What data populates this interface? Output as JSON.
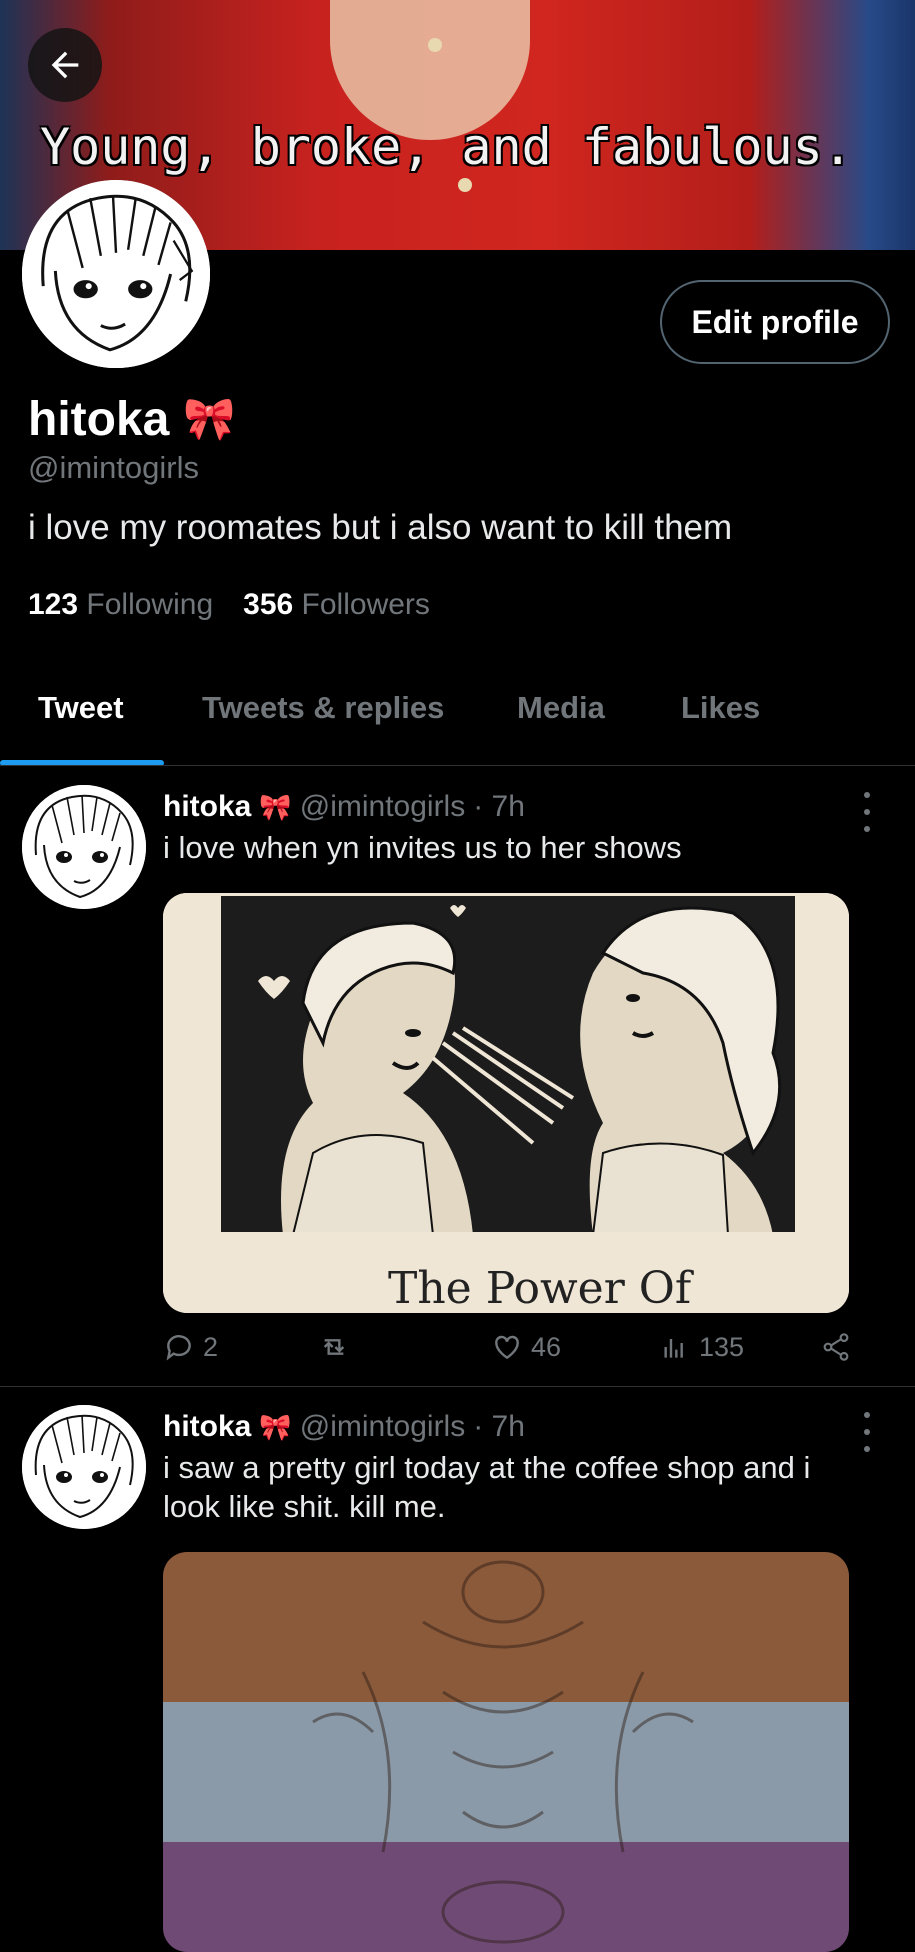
{
  "banner": {
    "caption": "Young, broke, and fabulous."
  },
  "profile": {
    "name": "hitoka",
    "name_emoji": "🎀",
    "handle": "@imintogirls",
    "bio": "i love my roomates but i also want to kill them",
    "following_count": "123",
    "following_label": "Following",
    "followers_count": "356",
    "followers_label": "Followers",
    "edit_label": "Edit profile"
  },
  "tabs": [
    {
      "label": "Tweet",
      "active": true
    },
    {
      "label": "Tweets & replies",
      "active": false
    },
    {
      "label": "Media",
      "active": false
    },
    {
      "label": "Likes",
      "active": false
    }
  ],
  "tweets": [
    {
      "name": "hitoka",
      "emoji": "🎀",
      "handle": "@imintogirls",
      "time": "· 7h",
      "text": "i love when yn invites us to her shows",
      "media_caption": "The Power Of",
      "replies": "2",
      "retweets": "",
      "likes": "46",
      "views": "135"
    },
    {
      "name": "hitoka",
      "emoji": "🎀",
      "handle": "@imintogirls",
      "time": "· 7h",
      "text": "i saw a pretty girl today at the coffee shop and i look like shit. kill me."
    }
  ],
  "colors": {
    "accent": "#1d9bf0",
    "background": "#000000",
    "secondary_text": "#71767b"
  }
}
